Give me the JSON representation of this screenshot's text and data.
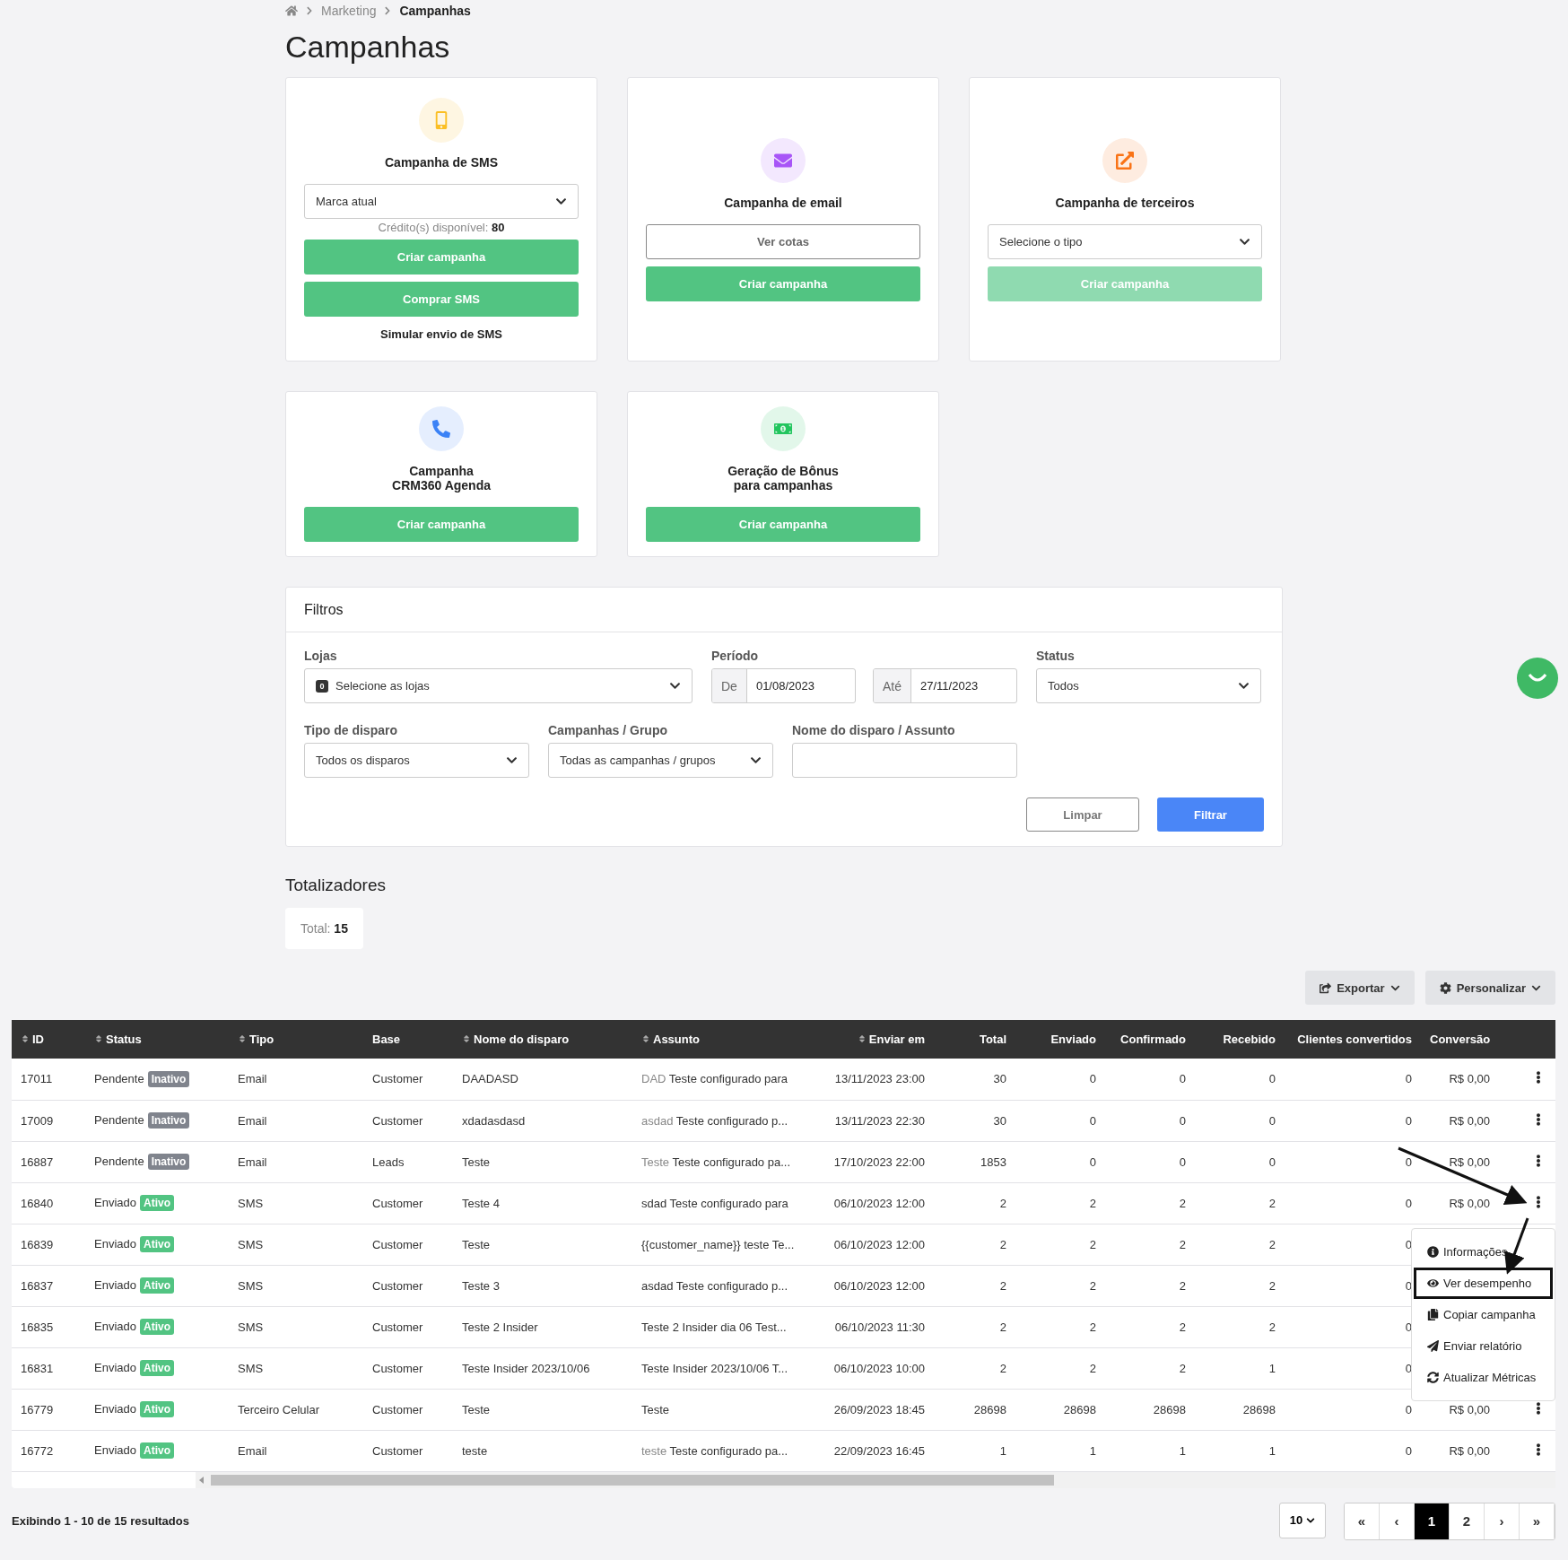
{
  "breadcrumb": [
    "Marketing",
    "Campanhas"
  ],
  "title": "Campanhas",
  "cards": [
    {
      "color": "#fbbf24",
      "title": "Campanha de SMS",
      "items": [
        {
          "kind": "select",
          "text": "Marca atual"
        },
        {
          "kind": "credit",
          "text": "Crédito(s) disponível:",
          "value": "80"
        },
        {
          "kind": "button",
          "text": "Criar campanha",
          "disabled": false
        },
        {
          "kind": "button",
          "text": "Comprar SMS",
          "disabled": false
        },
        {
          "kind": "link",
          "text": "Simular envio de SMS"
        }
      ]
    },
    {
      "color": "#a855f7",
      "title": "Campanha de email",
      "items": [
        {
          "kind": "outline",
          "text": "Ver cotas"
        },
        {
          "kind": "button",
          "text": "Criar campanha",
          "disabled": false
        }
      ]
    },
    {
      "color": "#f97316",
      "title": "Campanha de terceiros",
      "items": [
        {
          "kind": "select",
          "text": "Selecione o tipo"
        },
        {
          "kind": "button",
          "text": "Criar campanha",
          "disabled": true
        }
      ]
    },
    {
      "color": "#3b82f6",
      "title": "Campanha\nCRM360 Agenda",
      "items": [
        {
          "kind": "button",
          "text": "Criar campanha",
          "disabled": false
        }
      ]
    },
    {
      "color": "#22c55e",
      "title": "Geração de Bônus\npara campanhas",
      "items": [
        {
          "kind": "button",
          "text": "Criar campanha",
          "disabled": false
        }
      ]
    }
  ],
  "filters": {
    "title": "Filtros",
    "lojas": {
      "label": "Lojas",
      "count": "0",
      "value": "Selecione as lojas"
    },
    "periodo": {
      "label": "Período",
      "from_label": "De",
      "from": "01/08/2023",
      "to_label": "Até",
      "to": "27/11/2023"
    },
    "status": {
      "label": "Status",
      "value": "Todos"
    },
    "tipo": {
      "label": "Tipo de disparo",
      "value": "Todos os disparos"
    },
    "grupo": {
      "label": "Campanhas / Grupo",
      "value": "Todas as campanhas / grupos"
    },
    "nome": {
      "label": "Nome do disparo / Assunto"
    },
    "buttons": [
      "Limpar",
      "Filtrar"
    ]
  },
  "totals": {
    "title": "Totalizadores",
    "total": "Total: **15**"
  },
  "toolbar": [
    "Exportar",
    "Personalizar"
  ],
  "table": {
    "columns": [
      {
        "label": "ID",
        "sortable": true
      },
      {
        "label": "Status",
        "sortable": true
      },
      {
        "label": "Tipo",
        "sortable": true
      },
      {
        "label": "Base",
        "sortable": false
      },
      {
        "label": "Nome do disparo",
        "sortable": true
      },
      {
        "label": "Assunto",
        "sortable": true
      },
      {
        "label": "Enviar em",
        "sortable": true
      },
      {
        "label": "Total",
        "sortable": false
      },
      {
        "label": "Enviado",
        "sortable": false
      },
      {
        "label": "Confirmado",
        "sortable": false
      },
      {
        "label": "Recebido",
        "sortable": false
      },
      {
        "label": "Clientes convertidos",
        "sortable": false
      },
      {
        "label": "Conversão",
        "sortable": false
      }
    ],
    "rows": [
      {
        "id": "17011",
        "status": "Pendente",
        "badge": "Inativo",
        "active": false,
        "tipo": "Email",
        "base": "Customer",
        "nome": "DAADASD",
        "subject_tag": "DAD",
        "subject": "Teste configurado para",
        "enviar": "13/11/2023 23:00",
        "total": "30",
        "enviado": "0",
        "confirmado": "0",
        "recebido": "0",
        "clientes": "0",
        "conversao": "R$ 0,00"
      },
      {
        "id": "17009",
        "status": "Pendente",
        "badge": "Inativo",
        "active": false,
        "tipo": "Email",
        "base": "Customer",
        "nome": "xdadasdasd",
        "subject_tag": "asdad",
        "subject": "Teste configurado p...",
        "enviar": "13/11/2023 22:30",
        "total": "30",
        "enviado": "0",
        "confirmado": "0",
        "recebido": "0",
        "clientes": "0",
        "conversao": "R$ 0,00"
      },
      {
        "id": "16887",
        "status": "Pendente",
        "badge": "Inativo",
        "active": false,
        "tipo": "Email",
        "base": "Leads",
        "nome": "Teste",
        "subject_tag": "Teste",
        "subject": "Teste configurado pa...",
        "enviar": "17/10/2023 22:00",
        "total": "1853",
        "enviado": "0",
        "confirmado": "0",
        "recebido": "0",
        "clientes": "0",
        "conversao": "R$ 0,00"
      },
      {
        "id": "16840",
        "status": "Enviado",
        "badge": "Ativo",
        "active": true,
        "tipo": "SMS",
        "base": "Customer",
        "nome": "Teste 4",
        "subject": "sdad Teste configurado para",
        "enviar": "06/10/2023 12:00",
        "total": "2",
        "enviado": "2",
        "confirmado": "2",
        "recebido": "2",
        "clientes": "0",
        "conversao": "R$ 0,00"
      },
      {
        "id": "16839",
        "status": "Enviado",
        "badge": "Ativo",
        "active": true,
        "tipo": "SMS",
        "base": "Customer",
        "nome": "Teste",
        "subject": "{{customer_name}} teste Te...",
        "enviar": "06/10/2023 12:00",
        "total": "2",
        "enviado": "2",
        "confirmado": "2",
        "recebido": "2",
        "clientes": "0"
      },
      {
        "id": "16837",
        "status": "Enviado",
        "badge": "Ativo",
        "active": true,
        "tipo": "SMS",
        "base": "Customer",
        "nome": "Teste 3",
        "subject": "asdad Teste configurado p...",
        "enviar": "06/10/2023 12:00",
        "total": "2",
        "enviado": "2",
        "confirmado": "2",
        "recebido": "2",
        "clientes": "0"
      },
      {
        "id": "16835",
        "status": "Enviado",
        "badge": "Ativo",
        "active": true,
        "tipo": "SMS",
        "base": "Customer",
        "nome": "Teste 2 Insider",
        "subject": "Teste 2 Insider dia 06 Test...",
        "enviar": "06/10/2023 11:30",
        "total": "2",
        "enviado": "2",
        "confirmado": "2",
        "recebido": "2",
        "clientes": "0"
      },
      {
        "id": "16831",
        "status": "Enviado",
        "badge": "Ativo",
        "active": true,
        "tipo": "SMS",
        "base": "Customer",
        "nome": "Teste Insider 2023/10/06",
        "subject": "Teste Insider 2023/10/06 T...",
        "enviar": "06/10/2023 10:00",
        "total": "2",
        "enviado": "2",
        "confirmado": "2",
        "recebido": "1",
        "clientes": "0"
      },
      {
        "id": "16779",
        "status": "Enviado",
        "badge": "Ativo",
        "active": true,
        "tipo": "Terceiro Celular",
        "base": "Customer",
        "nome": "Teste",
        "subject": "Teste",
        "enviar": "26/09/2023 18:45",
        "total": "28698",
        "enviado": "28698",
        "confirmado": "28698",
        "recebido": "28698",
        "clientes": "0",
        "conversao": "R$ 0,00"
      },
      {
        "id": "16772",
        "status": "Enviado",
        "badge": "Ativo",
        "active": true,
        "tipo": "Email",
        "base": "Customer",
        "nome": "teste",
        "subject_tag": "teste",
        "subject": "Teste configurado pa...",
        "enviar": "22/09/2023 16:45",
        "total": "1",
        "enviado": "1",
        "confirmado": "1",
        "recebido": "1",
        "clientes": "0",
        "conversao": "R$ 0,00"
      }
    ]
  },
  "row_menu": [
    {
      "label": "Informações",
      "highlighted": false
    },
    {
      "label": "Ver desempenho",
      "highlighted": true
    },
    {
      "label": "Copiar campanha",
      "highlighted": false
    },
    {
      "label": "Enviar relatório",
      "highlighted": false
    },
    {
      "label": "Atualizar Métricas",
      "highlighted": false
    }
  ],
  "footer": {
    "summary": "Exibindo 1 - 10 de 15 resultados",
    "page_size": "10",
    "pages": [
      {
        "label": "«",
        "selected": false
      },
      {
        "label": "‹",
        "selected": false
      },
      {
        "label": "1",
        "selected": true
      },
      {
        "label": "2",
        "selected": false
      },
      {
        "label": "›",
        "selected": false
      },
      {
        "label": "»",
        "selected": false
      }
    ]
  }
}
